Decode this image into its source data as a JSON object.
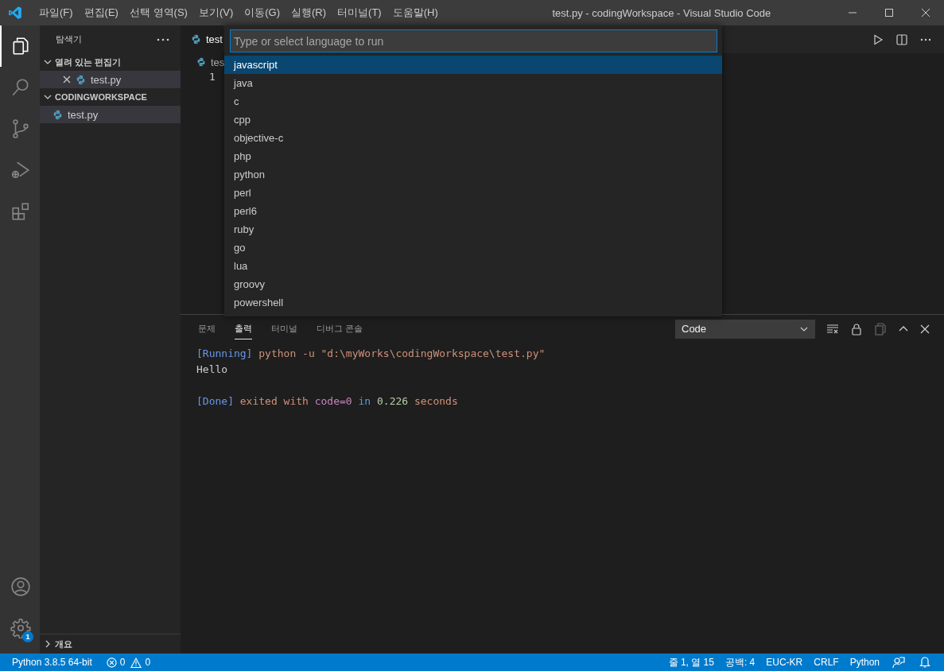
{
  "title_bar": {
    "menu": [
      "파일(F)",
      "편집(E)",
      "선택 영역(S)",
      "보기(V)",
      "이동(G)",
      "실행(R)",
      "터미널(T)",
      "도움말(H)"
    ],
    "title": "test.py - codingWorkspace - Visual Studio Code"
  },
  "activity_bar": {
    "items": [
      {
        "kind": "explorer",
        "selected": true
      },
      {
        "kind": "search",
        "selected": false
      },
      {
        "kind": "source-control",
        "selected": false
      },
      {
        "kind": "run",
        "selected": false
      },
      {
        "kind": "extensions",
        "selected": false
      }
    ],
    "settings_badge": "1"
  },
  "sidebar": {
    "title": "탐색기",
    "sections": [
      {
        "title": "열려 있는 편집기",
        "expanded": true,
        "items": [
          {
            "name": "test.py",
            "selected": true,
            "closable": true
          }
        ]
      },
      {
        "title": "CODINGWORKSPACE",
        "expanded": true,
        "items": [
          {
            "name": "test.py",
            "selected": true,
            "closable": false
          }
        ]
      },
      {
        "title": "개요",
        "expanded": false
      }
    ]
  },
  "editor": {
    "tab": "test",
    "breadcrumb": "tes",
    "line_numbers": [
      "1"
    ]
  },
  "quick_pick": {
    "placeholder": "Type or select language to run",
    "options": [
      {
        "label": "javascript",
        "selected": true
      },
      {
        "label": "java",
        "selected": false
      },
      {
        "label": "c",
        "selected": false
      },
      {
        "label": "cpp",
        "selected": false
      },
      {
        "label": "objective-c",
        "selected": false
      },
      {
        "label": "php",
        "selected": false
      },
      {
        "label": "python",
        "selected": false
      },
      {
        "label": "perl",
        "selected": false
      },
      {
        "label": "perl6",
        "selected": false
      },
      {
        "label": "ruby",
        "selected": false
      },
      {
        "label": "go",
        "selected": false
      },
      {
        "label": "lua",
        "selected": false
      },
      {
        "label": "groovy",
        "selected": false
      },
      {
        "label": "powershell",
        "selected": false
      }
    ]
  },
  "panel": {
    "tabs": [
      {
        "label": "문제",
        "selected": false
      },
      {
        "label": "출력",
        "selected": true
      },
      {
        "label": "터미널",
        "selected": false
      },
      {
        "label": "디버그 콘솔",
        "selected": false
      }
    ],
    "dropdown": "Code",
    "output": [
      {
        "kind": "text",
        "segments": [
          {
            "kind": "tag",
            "text": "[Running]"
          },
          {
            "kind": "text",
            "text": "python -u \"d:\\myWorks\\codingWorkspace\\test.py\""
          }
        ]
      },
      {
        "kind": "text",
        "segments": [
          {
            "kind": "plain",
            "text": "Hello"
          }
        ]
      },
      {
        "kind": "blank"
      },
      {
        "kind": "text",
        "segments": [
          {
            "kind": "tag",
            "text": "[Done]"
          },
          {
            "kind": "text",
            "text": "exited with"
          },
          {
            "kind": "keyword",
            "text": "code=0"
          },
          {
            "kind": "word",
            "text": "in"
          },
          {
            "kind": "number",
            "text": "0.226"
          },
          {
            "kind": "text",
            "text": "seconds"
          }
        ]
      }
    ]
  },
  "status_bar": {
    "interpreter": "Python 3.8.5 64-bit",
    "errors": "0",
    "warnings": "0",
    "position": "줄 1, 열 15",
    "indent": "공백: 4",
    "encoding": "EUC-KR",
    "eol": "CRLF",
    "language": "Python"
  }
}
